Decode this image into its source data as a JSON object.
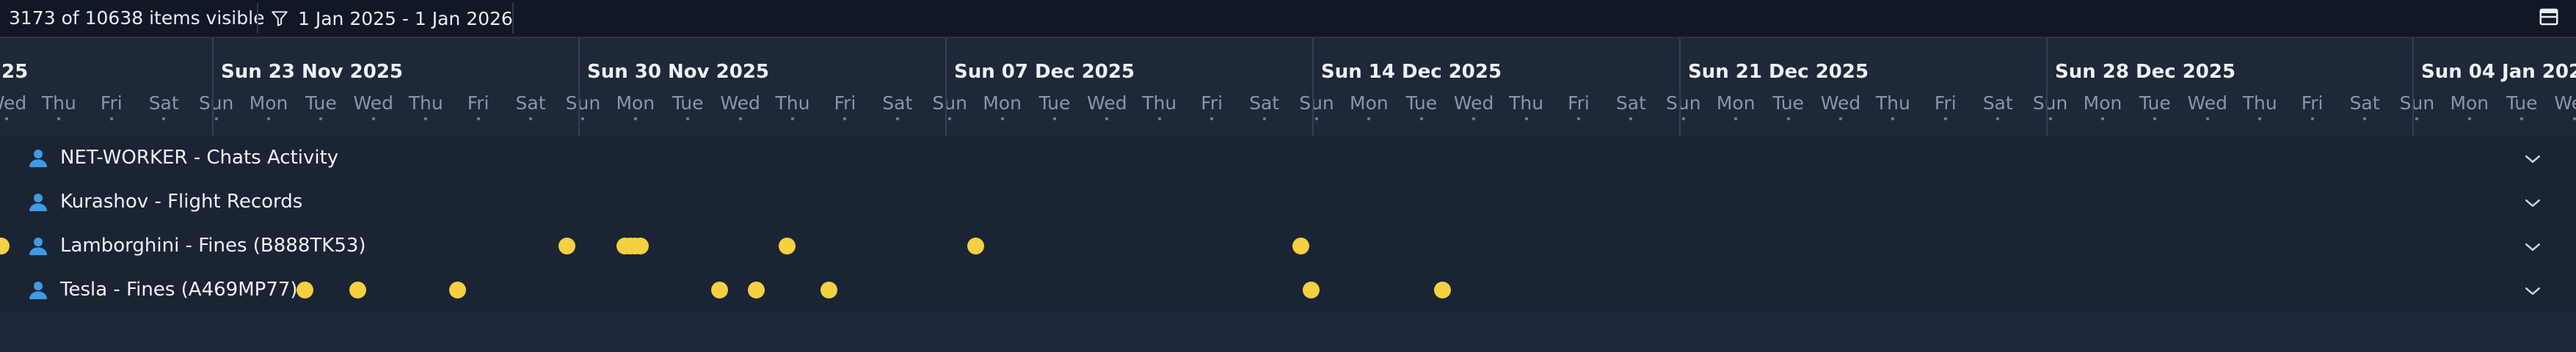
{
  "toolbar": {
    "items_visible": "3173 of 10638 items visible",
    "date_filter": "1 Jan 2025 - 1 Jan 2026",
    "filter_icon": "funnel-icon",
    "view_icon": "layout-toggle-icon"
  },
  "timeline": {
    "partial_week_label": "25",
    "weeks": [
      "Sun 23 Nov 2025",
      "Sun 30 Nov 2025",
      "Sun 07 Dec 2025",
      "Sun 14 Dec 2025",
      "Sun 21 Dec 2025",
      "Sun 28 Dec 2025",
      "Sun 04 Jan 2026"
    ],
    "days": [
      "Wed",
      "Thu",
      "Fri",
      "Sat",
      "Sun",
      "Mon",
      "Tue",
      "Wed",
      "Thu",
      "Fri",
      "Sat",
      "Sun",
      "Mon",
      "Tue",
      "Wed",
      "Thu",
      "Fri",
      "Sat",
      "Sun",
      "Mon",
      "Tue",
      "Wed",
      "Thu",
      "Fri",
      "Sat",
      "Sun",
      "Mon",
      "Tue",
      "Wed",
      "Thu",
      "Fri",
      "Sat",
      "Sun",
      "Mon",
      "Tue",
      "Wed",
      "Thu",
      "Fri",
      "Sat",
      "Sun",
      "Mon",
      "Tue",
      "Wed",
      "Thu",
      "Fri",
      "Sat",
      "Sun",
      "Mon",
      "Tue",
      "Wed"
    ]
  },
  "rows": [
    {
      "label": "NET-WORKER - Chats Activity",
      "icon": "user-icon",
      "events": []
    },
    {
      "label": "Kurashov - Flight Records",
      "icon": "user-icon",
      "events": []
    },
    {
      "label": "Lamborghini - Fines (B888TK53)",
      "icon": "user-icon",
      "events": [
        -0.1,
        10.7,
        11.8,
        11.9,
        12.0,
        12.1,
        14.9,
        18.5,
        24.7
      ]
    },
    {
      "label": "Tesla - Fines (A469MP77)",
      "icon": "user-icon",
      "events": [
        5.7,
        6.7,
        8.6,
        13.6,
        14.3,
        15.7,
        24.9,
        27.4
      ]
    }
  ],
  "colors": {
    "toolbar_bg": "#111825",
    "header_bg": "#1f2839",
    "body_bg": "#1b2434",
    "event": "#f5d040",
    "user_icon": "#3f9be6"
  }
}
